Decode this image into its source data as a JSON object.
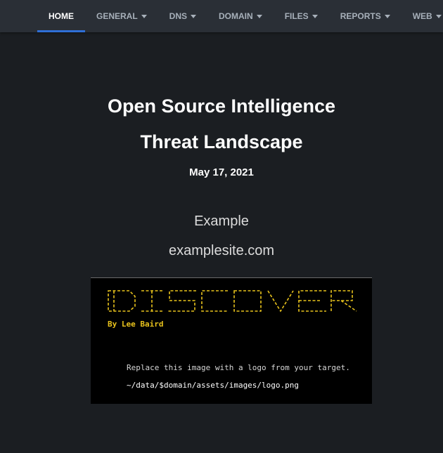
{
  "nav": {
    "items": [
      {
        "label": "HOME",
        "dropdown": false,
        "active": true
      },
      {
        "label": "GENERAL",
        "dropdown": true,
        "active": false
      },
      {
        "label": "DNS",
        "dropdown": true,
        "active": false
      },
      {
        "label": "DOMAIN",
        "dropdown": true,
        "active": false
      },
      {
        "label": "FILES",
        "dropdown": true,
        "active": false
      },
      {
        "label": "REPORTS",
        "dropdown": true,
        "active": false
      },
      {
        "label": "WEB",
        "dropdown": true,
        "active": false
      }
    ]
  },
  "header": {
    "title_line1": "Open Source Intelligence",
    "title_line2": "Threat Landscape",
    "date": "May 17, 2021"
  },
  "target": {
    "company": "Example",
    "domain": "examplesite.com"
  },
  "logo": {
    "wordmark": "DISCOVER",
    "byline": "By Lee Baird",
    "note": "Replace this image with a logo from your target.",
    "path": "~/data/$domain/assets/images/logo.png"
  },
  "colors": {
    "background": "#1b1e22",
    "navbar": "#2a2f36",
    "active_underline": "#2f6fd6",
    "logo_yellow": "#e8c21c"
  }
}
